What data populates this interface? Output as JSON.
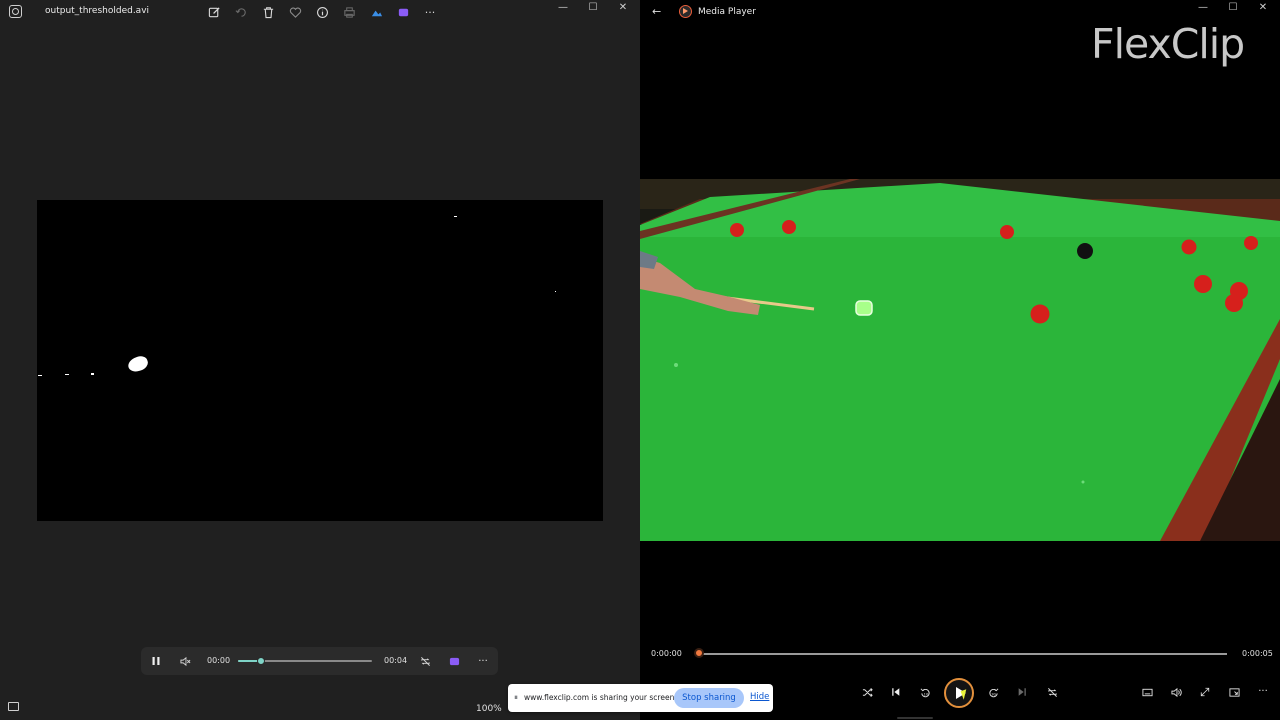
{
  "photos": {
    "title": "output_thresholded.avi",
    "toolbar": [
      "edit-icon",
      "rotate-icon",
      "delete-icon",
      "favorite-icon",
      "info-icon",
      "print-icon",
      "onedrive-icon",
      "clipchamp-icon",
      "more-icon"
    ],
    "player": {
      "current_time": "00:00",
      "duration": "00:04",
      "progress": 0.17
    },
    "zoom": "100%"
  },
  "share_bar": {
    "message": "www.flexclip.com is sharing your screen.",
    "stop_label": "Stop sharing",
    "hide_label": "Hide"
  },
  "media": {
    "title": "Media Player",
    "watermark": "FlexClip",
    "current_time": "0:00:00",
    "duration": "0:00:05",
    "progress": 0.0,
    "colors": {
      "accent": "#f1793f",
      "table_felt": "#2bb53a",
      "red_ball": "#d6201c",
      "cushion": "#8a2f1c"
    }
  }
}
